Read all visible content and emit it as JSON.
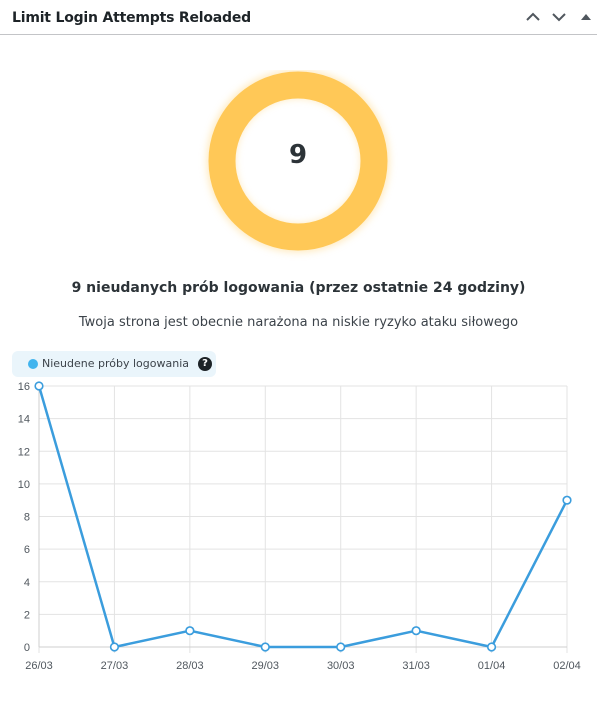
{
  "widget": {
    "title": "Limit Login Attempts Reloaded",
    "controls": {
      "move_up_icon": "chevron-up-icon",
      "move_down_icon": "chevron-down-icon",
      "toggle_icon": "caret-up-icon"
    }
  },
  "summary": {
    "failed_count": "9",
    "headline": "9 nieudanych prób logowania (przez ostatnie 24 godziny)",
    "risk_text": "Twoja strona jest obecnie narażona na niskie ryzyko ataku siłowego",
    "gauge_color": "#ffc857"
  },
  "legend": {
    "label": "Nieudene próby logowania",
    "help": "?"
  },
  "chart_data": {
    "type": "line",
    "categories": [
      "26/03",
      "27/03",
      "28/03",
      "29/03",
      "30/03",
      "31/03",
      "01/04",
      "02/04"
    ],
    "series": [
      {
        "name": "Nieudene próby logowania",
        "values": [
          16,
          0,
          1,
          0,
          0,
          1,
          0,
          9
        ],
        "color": "#3b9ddd"
      }
    ],
    "yticks": [
      0,
      2,
      4,
      6,
      8,
      10,
      12,
      14,
      16
    ],
    "ylim": [
      0,
      16
    ],
    "grid": true,
    "legend_position": "top-left"
  }
}
